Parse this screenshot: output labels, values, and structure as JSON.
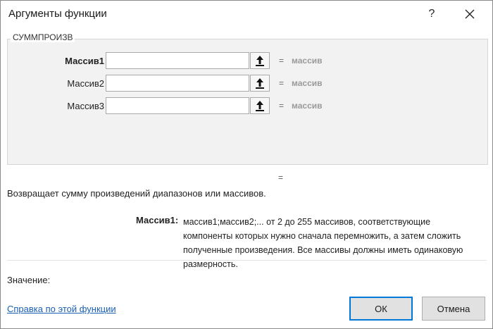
{
  "dialog": {
    "title": "Аргументы функции",
    "help_glyph": "?",
    "function_name": "СУММПРОИЗВ"
  },
  "arguments": [
    {
      "label": "Массив1",
      "value": "",
      "eq": "=",
      "result": "массив",
      "bold": true
    },
    {
      "label": "Массив2",
      "value": "",
      "eq": "=",
      "result": "массив",
      "bold": false
    },
    {
      "label": "Массив3",
      "value": "",
      "eq": "=",
      "result": "массив",
      "bold": false
    }
  ],
  "result_eq": "=",
  "description": "Возвращает сумму произведений диапазонов или массивов.",
  "arg_description": {
    "name": "Массив1:",
    "text": "массив1;массив2;... от 2 до 255 массивов, соответствующие компоненты которых нужно сначала перемножить, а затем сложить полученные произведения. Все массивы должны иметь одинаковую размерность."
  },
  "value_label": "Значение:",
  "help_link": "Справка по этой функции",
  "buttons": {
    "ok": "ОК",
    "cancel": "Отмена"
  },
  "icons": {
    "help": "help-icon",
    "close": "close-icon",
    "collapse": "arrow-up-icon"
  },
  "colors": {
    "accent": "#0078d7",
    "link": "#1a5fb4",
    "muted": "#9a9a9a"
  }
}
